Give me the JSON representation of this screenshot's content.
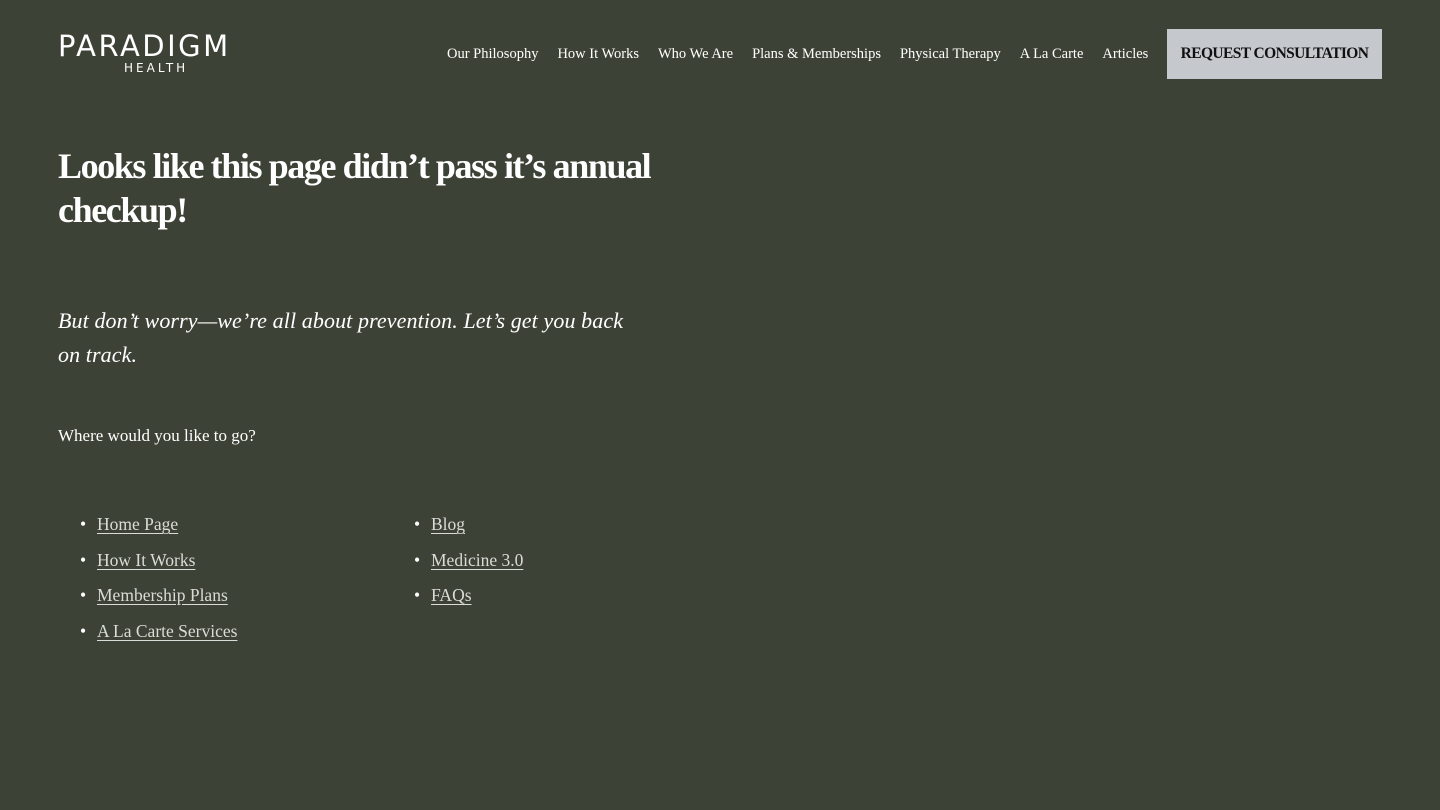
{
  "header": {
    "logo": {
      "wordmark": "PARADIGM",
      "sub": "HEALTH"
    },
    "nav": [
      {
        "label": "Our Philosophy"
      },
      {
        "label": "How It Works"
      },
      {
        "label": "Who We Are"
      },
      {
        "label": "Plans & Memberships"
      },
      {
        "label": "Physical Therapy"
      },
      {
        "label": "A La Carte"
      },
      {
        "label": "Articles"
      }
    ],
    "cta_label": "REQUEST CONSULTATION"
  },
  "main": {
    "heading": "Looks like this page didn’t pass it’s annual checkup!",
    "subheading": "But don’t worry—we’re all about prevention. Let’s get you back on track.",
    "prompt": "Where would you like to go?",
    "links_left": [
      {
        "label": "Home Page"
      },
      {
        "label": "How It Works"
      },
      {
        "label": "Membership Plans"
      },
      {
        "label": "A La Carte Services"
      }
    ],
    "links_right": [
      {
        "label": "Blog"
      },
      {
        "label": "Medicine 3.0"
      },
      {
        "label": "FAQs"
      }
    ],
    "bullet": "•"
  },
  "colors": {
    "background": "#3d4236",
    "cta_background": "#c5c9cd",
    "text": "#ffffff",
    "link": "#d9dcd7"
  }
}
